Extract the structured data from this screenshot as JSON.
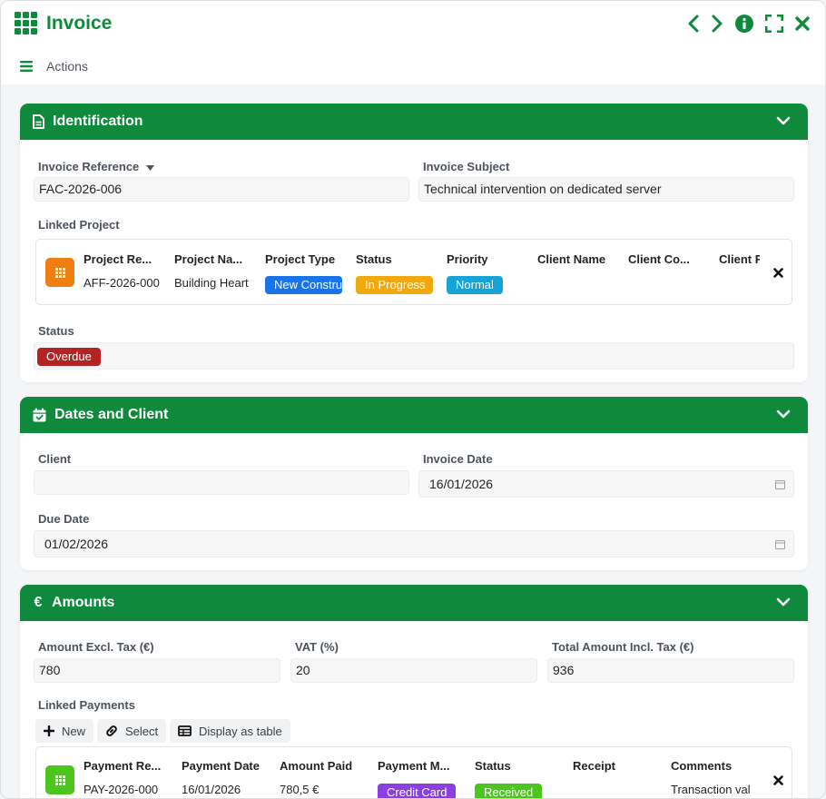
{
  "window": {
    "title": "Invoice",
    "actions_label": "Actions"
  },
  "colors": {
    "brand": "#0f8a3c",
    "overdue": "#b42323",
    "new_construction": "#1a73e8",
    "in_progress": "#f2a90f",
    "normal": "#17a2d8",
    "credit_card": "#8a3fe0",
    "received": "#4cc51e",
    "project_icon": "#f07f12",
    "payment_icon": "#4cc51e"
  },
  "identification": {
    "title": "Identification",
    "invoice_reference_label": "Invoice Reference",
    "invoice_reference_value": "FAC-2026-006",
    "invoice_subject_label": "Invoice Subject",
    "invoice_subject_value": "Technical intervention on dedicated server",
    "linked_project_label": "Linked Project",
    "project_columns": [
      "Project Re...",
      "Project Na...",
      "Project Type",
      "Status",
      "Priority",
      "Client Name",
      "Client Co...",
      "Client F"
    ],
    "project_row": {
      "reference": "AFF-2026-000",
      "name": "Building Heart",
      "type": "New Constru",
      "status": "In Progress",
      "priority": "Normal"
    },
    "status_label": "Status",
    "status_value": "Overdue"
  },
  "dates_client": {
    "title": "Dates and Client",
    "client_label": "Client",
    "client_value": "",
    "invoice_date_label": "Invoice Date",
    "invoice_date_value": "16/01/2026",
    "due_date_label": "Due Date",
    "due_date_value": "01/02/2026"
  },
  "amounts": {
    "title": "Amounts",
    "currency_symbol": "€",
    "excl_tax_label": "Amount Excl. Tax (€)",
    "excl_tax_value": "780",
    "vat_label": "VAT (%)",
    "vat_value": "20",
    "total_label": "Total Amount Incl. Tax (€)",
    "total_value": "936",
    "linked_payments_label": "Linked Payments",
    "toolbar": {
      "new_label": "New",
      "select_label": "Select",
      "table_label": "Display as table"
    },
    "payment_columns": [
      "Payment Re...",
      "Payment Date",
      "Amount Paid",
      "Payment M...",
      "Status",
      "Receipt",
      "Comments"
    ],
    "payment_row": {
      "reference": "PAY-2026-000",
      "date": "16/01/2026",
      "amount": "780,5 €",
      "method": "Credit Card",
      "status": "Received",
      "receipt": "",
      "comments": "Transaction val"
    }
  }
}
